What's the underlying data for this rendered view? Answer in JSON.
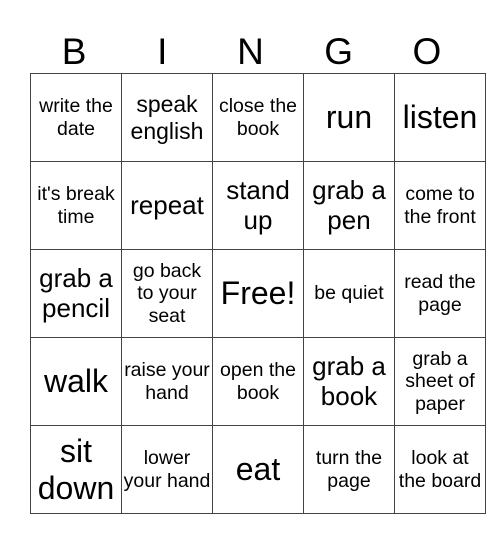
{
  "header": [
    "B",
    "I",
    "N",
    "G",
    "O"
  ],
  "cells": [
    [
      {
        "text": "write the date",
        "size": "s1"
      },
      {
        "text": "speak english",
        "size": "s2"
      },
      {
        "text": "close the book",
        "size": "s1"
      },
      {
        "text": "run",
        "size": "s4"
      },
      {
        "text": "listen",
        "size": "s4"
      }
    ],
    [
      {
        "text": "it's break time",
        "size": "s1"
      },
      {
        "text": "repeat",
        "size": "s3"
      },
      {
        "text": "stand up",
        "size": "s3"
      },
      {
        "text": "grab a pen",
        "size": "s3"
      },
      {
        "text": "come to the front",
        "size": "s1"
      }
    ],
    [
      {
        "text": "grab a pencil",
        "size": "s3"
      },
      {
        "text": "go back to your seat",
        "size": "s1"
      },
      {
        "text": "Free!",
        "size": "s4"
      },
      {
        "text": "be quiet",
        "size": "s1"
      },
      {
        "text": "read the page",
        "size": "s1"
      }
    ],
    [
      {
        "text": "walk",
        "size": "s4"
      },
      {
        "text": "raise your hand",
        "size": "s1"
      },
      {
        "text": "open the book",
        "size": "s1"
      },
      {
        "text": "grab a book",
        "size": "s3"
      },
      {
        "text": "grab a sheet of paper",
        "size": "s1"
      }
    ],
    [
      {
        "text": "sit down",
        "size": "s4"
      },
      {
        "text": "lower your hand",
        "size": "s1"
      },
      {
        "text": "eat",
        "size": "s4"
      },
      {
        "text": "turn the page",
        "size": "s1"
      },
      {
        "text": "look at the board",
        "size": "s1"
      }
    ]
  ]
}
